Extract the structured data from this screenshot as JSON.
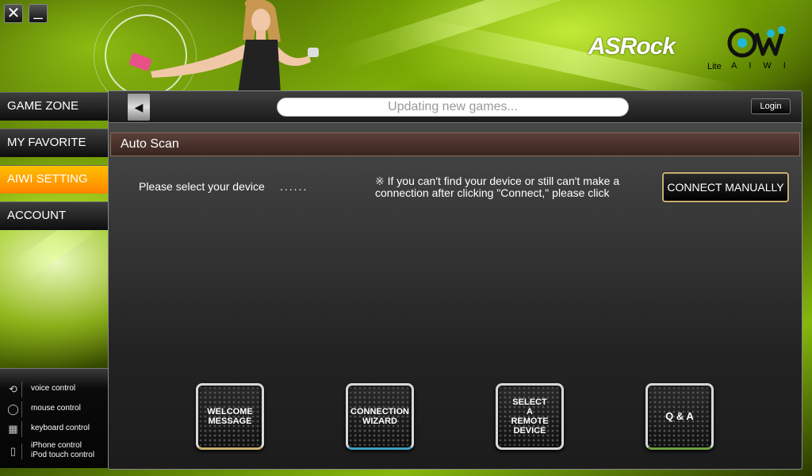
{
  "window": {
    "close_glyph": "✕",
    "minimize_glyph": "_"
  },
  "brand": {
    "logo_text": "ASRock",
    "edition": "Lite",
    "product_letters": "AIWI"
  },
  "menu": {
    "items": [
      {
        "label": "GAME ZONE",
        "active": false
      },
      {
        "label": "MY FAVORITE",
        "active": false
      },
      {
        "label": "AIWI SETTING",
        "active": true
      },
      {
        "label": "ACCOUNT",
        "active": false
      }
    ],
    "accent_color": "#ff9a00"
  },
  "controls": [
    {
      "icon": "voice-control-icon",
      "label": "voice control"
    },
    {
      "icon": "mouse-icon",
      "label": "mouse control"
    },
    {
      "icon": "keyboard-icon",
      "label": "keyboard control"
    },
    {
      "icon": "iphone-icon",
      "label_line1": "iPhone control",
      "label_line2": "iPod touch  control"
    }
  ],
  "topbar": {
    "status_text": "Updating new games...",
    "login_label": "Login"
  },
  "section": {
    "title": "Auto Scan"
  },
  "device": {
    "prompt": "Please select your device",
    "dots": "......",
    "note_mark": "※",
    "note_text": "If you can't find your device or still can't make a connection after clicking \"Connect,\" please click",
    "connect_manually_label": "CONNECT MANUALLY"
  },
  "tiles": [
    {
      "lines": [
        "WELCOME",
        "MESSAGE"
      ],
      "accent": "#c8b070"
    },
    {
      "lines": [
        "CONNECTION",
        "WIZARD"
      ],
      "accent": "#40a0c0"
    },
    {
      "lines": [
        "SELECT",
        "A",
        "REMOTE",
        "DEVICE"
      ],
      "accent": "#c0c0c0"
    },
    {
      "lines": [
        "Q & A"
      ],
      "accent": "#70a040"
    }
  ]
}
